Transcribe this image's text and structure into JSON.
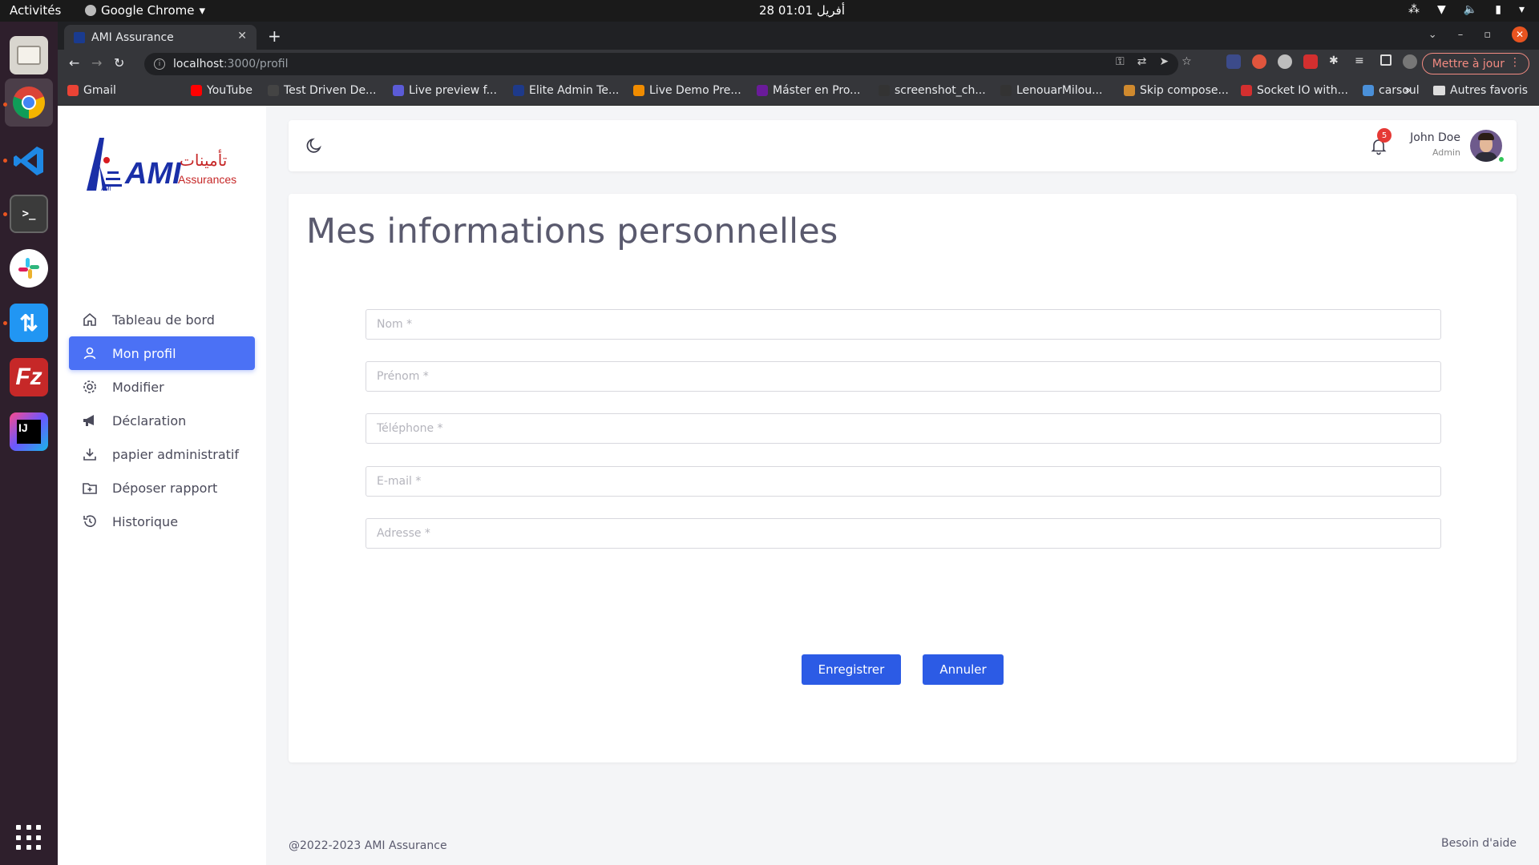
{
  "system": {
    "activities": "Activités",
    "app_menu": "Google Chrome",
    "clock": "28 أفريل  01:01"
  },
  "dock": {
    "apps": [
      "files",
      "chrome",
      "vscode",
      "terminal",
      "slack",
      "transfer",
      "filezilla",
      "intellij"
    ]
  },
  "browser": {
    "tab_title": "AMI Assurance",
    "url_host": "localhost",
    "url_path": ":3000/profil",
    "update_label": "Mettre à jour",
    "bookmarks": [
      {
        "label": "Gmail",
        "color": "#ea4335"
      },
      {
        "label": "YouTube",
        "color": "#ff0000"
      },
      {
        "label": "Test Driven De...",
        "color": "#444444"
      },
      {
        "label": "Live preview f...",
        "color": "#5b5bd6"
      },
      {
        "label": "Elite Admin Te...",
        "color": "#1e3a8a"
      },
      {
        "label": "Live Demo Pre...",
        "color": "#f08c00"
      },
      {
        "label": "Máster en Pro...",
        "color": "#6a1b9a"
      },
      {
        "label": "screenshot_ch...",
        "color": "#333333"
      },
      {
        "label": "LenouarMilou...",
        "color": "#333333"
      },
      {
        "label": "Skip compose...",
        "color": "#d08a2e"
      },
      {
        "label": "Socket IO with...",
        "color": "#d32f2f"
      },
      {
        "label": "carsoul",
        "color": "#4a90d9"
      }
    ],
    "more_bookmarks": "»",
    "other_bookmarks": "Autres favoris"
  },
  "sidebar": {
    "logo_text": "AMI",
    "logo_sub": "Assurances",
    "logo_arabic": "تأمينات",
    "items": [
      {
        "label": "Tableau de bord",
        "icon": "home-icon"
      },
      {
        "label": "Mon profil",
        "icon": "user-icon"
      },
      {
        "label": "Modifier",
        "icon": "gear-icon"
      },
      {
        "label": "Déclaration",
        "icon": "megaphone-icon"
      },
      {
        "label": "papier administratif",
        "icon": "download-icon"
      },
      {
        "label": "Déposer rapport",
        "icon": "folder-plus-icon"
      },
      {
        "label": "Historique",
        "icon": "history-icon"
      }
    ],
    "active_index": 1
  },
  "header": {
    "notification_count": "5",
    "user_name": "John Doe",
    "user_role": "Admin"
  },
  "form": {
    "title": "Mes informations personnelles",
    "fields": [
      {
        "placeholder": "Nom *",
        "value": ""
      },
      {
        "placeholder": "Prénom *",
        "value": ""
      },
      {
        "placeholder": "Téléphone *",
        "value": ""
      },
      {
        "placeholder": "E-mail *",
        "value": ""
      },
      {
        "placeholder": "Adresse *",
        "value": ""
      }
    ],
    "save_label": "Enregistrer",
    "cancel_label": "Annuler"
  },
  "footer": {
    "copyright": "@2022-2023 AMI Assurance",
    "help": "Besoin d'aide"
  },
  "colors": {
    "accent": "#4b71f5",
    "button": "#2c5be5",
    "badge": "#e53935",
    "online": "#34c759"
  }
}
